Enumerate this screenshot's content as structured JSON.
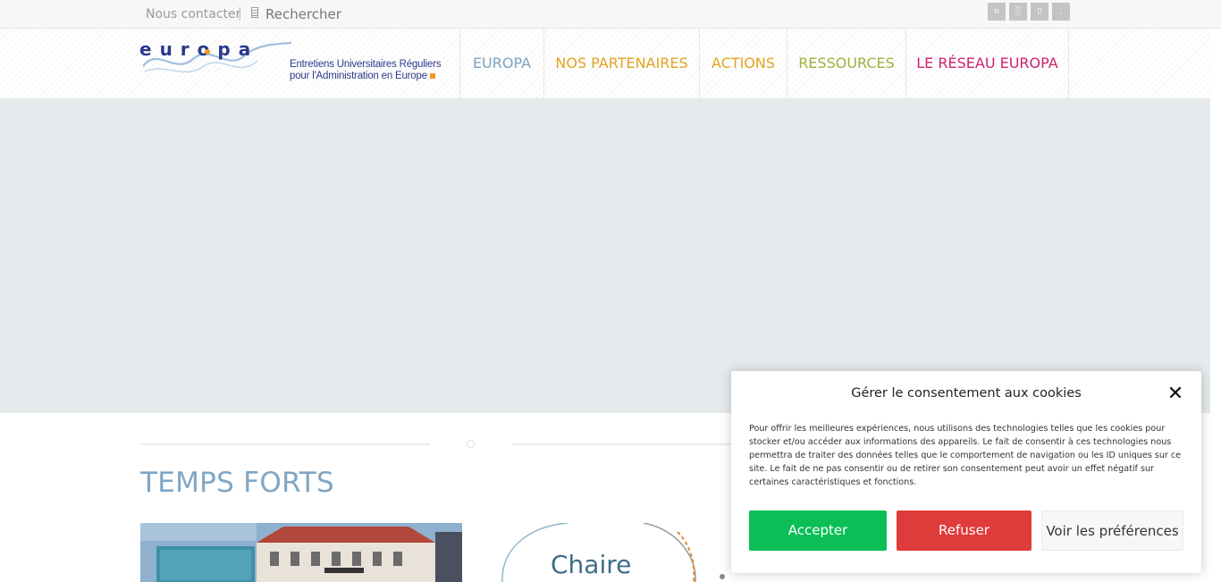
{
  "topbar": {
    "contact_label": "Nous contacter",
    "separator": "|",
    "search_label": "Rechercher",
    "social_icons": [
      {
        "name": "social-icon-1",
        "glyph": "n"
      },
      {
        "name": "social-icon-2",
        "glyph": "░"
      },
      {
        "name": "social-icon-3",
        "glyph": "▯"
      },
      {
        "name": "social-icon-4",
        "glyph": ","
      }
    ]
  },
  "logo": {
    "wordmark": "europa",
    "tagline_line1": "Entretiens Universitaires Réguliers",
    "tagline_line2": "pour l'Administration en Europe"
  },
  "nav": {
    "items": [
      {
        "label": "EUROPA",
        "color": "#7aa3c4"
      },
      {
        "label": "NOS PARTENAIRES",
        "color": "#e0a520"
      },
      {
        "label": "ACTIONS",
        "color": "#e0a520"
      },
      {
        "label": "RESSOURCES",
        "color": "#9bb43b"
      },
      {
        "label": "LE RÉSEAU EUROPA",
        "color": "#d0206e"
      }
    ]
  },
  "main": {
    "section_title": "TEMPS FORTS",
    "chaire_text": "Chaire"
  },
  "cookie": {
    "title": "Gérer le consentement aux cookies",
    "close_glyph": "✕",
    "body": "Pour offrir les meilleures expériences, nous utilisons des technologies telles que les cookies pour stocker et/ou accéder aux informations des appareils. Le fait de consentir à ces technologies nous permettra de traiter des données telles que le comportement de navigation ou les ID uniques sur ce site. Le fait de ne pas consentir ou de retirer son consentement peut avoir un effet négatif sur certaines caractéristiques et fonctions.",
    "accept_label": "Accepter",
    "refuse_label": "Refuser",
    "prefs_label": "Voir les préférences"
  }
}
